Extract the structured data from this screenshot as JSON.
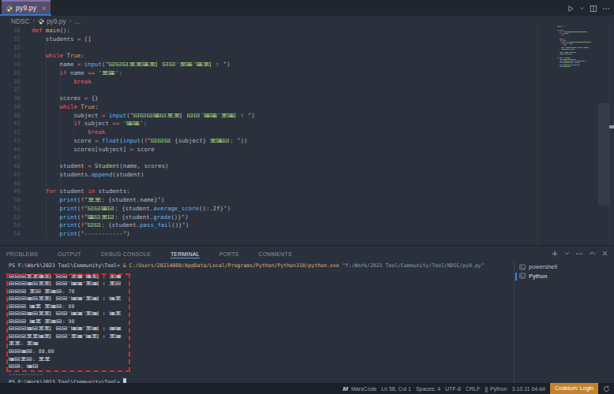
{
  "window": {
    "tab": {
      "label": "py9.py",
      "icon": "python-logo",
      "modified": false
    },
    "editor_actions": [
      "run-or-debug",
      "split-editor",
      "more-actions"
    ]
  },
  "breadcrumb": {
    "items": [
      "NDSC",
      "py9.py",
      "…"
    ]
  },
  "editor": {
    "first_visible_line": 30,
    "last_visible_line": 54,
    "lines": [
      {
        "n": 30,
        "tokens": [
          [
            "kw",
            "def"
          ],
          [
            "txt",
            " "
          ],
          [
            "defn",
            "main"
          ],
          [
            "txt",
            "():"
          ]
        ]
      },
      {
        "n": 31,
        "tokens": [
          [
            "txt",
            "    students "
          ],
          [
            "op",
            "="
          ],
          [
            "txt",
            " []"
          ]
        ]
      },
      {
        "n": 32,
        "tokens": []
      },
      {
        "n": 33,
        "tokens": [
          [
            "txt",
            "    "
          ],
          [
            "kw",
            "while"
          ],
          [
            "txt",
            " "
          ],
          [
            "num",
            "True"
          ],
          [
            "txt",
            ":"
          ]
        ]
      },
      {
        "n": 34,
        "tokens": [
          [
            "txt",
            "        name "
          ],
          [
            "op",
            "="
          ],
          [
            "txt",
            " "
          ],
          [
            "fn",
            "input"
          ],
          [
            "txt",
            "("
          ],
          [
            "str",
            "\"请输入学生姓名（输入'结束'退出）：\""
          ],
          [
            "txt",
            ")"
          ]
        ]
      },
      {
        "n": 35,
        "tokens": [
          [
            "txt",
            "        "
          ],
          [
            "kw",
            "if"
          ],
          [
            "txt",
            " name "
          ],
          [
            "op",
            "=="
          ],
          [
            "txt",
            " "
          ],
          [
            "str",
            "'结束'"
          ],
          [
            "txt",
            ":"
          ]
        ]
      },
      {
        "n": 36,
        "tokens": [
          [
            "txt",
            "            "
          ],
          [
            "kw",
            "break"
          ]
        ]
      },
      {
        "n": 37,
        "tokens": []
      },
      {
        "n": 38,
        "tokens": [
          [
            "txt",
            "        scores "
          ],
          [
            "op",
            "="
          ],
          [
            "txt",
            " {}"
          ]
        ]
      },
      {
        "n": 39,
        "tokens": [
          [
            "txt",
            "        "
          ],
          [
            "kw",
            "while"
          ],
          [
            "txt",
            " "
          ],
          [
            "num",
            "True"
          ],
          [
            "txt",
            ":"
          ]
        ]
      },
      {
        "n": 40,
        "tokens": [
          [
            "txt",
            "            subject "
          ],
          [
            "op",
            "="
          ],
          [
            "txt",
            " "
          ],
          [
            "fn",
            "input"
          ],
          [
            "txt",
            "("
          ],
          [
            "str",
            "\"请输入科目名称（输入'完成'结束）：\""
          ],
          [
            "txt",
            ")"
          ]
        ]
      },
      {
        "n": 41,
        "tokens": [
          [
            "txt",
            "            "
          ],
          [
            "kw",
            "if"
          ],
          [
            "txt",
            " subject "
          ],
          [
            "op",
            "=="
          ],
          [
            "txt",
            " "
          ],
          [
            "str",
            "'完成'"
          ],
          [
            "txt",
            ":"
          ]
        ]
      },
      {
        "n": 42,
        "tokens": [
          [
            "txt",
            "                "
          ],
          [
            "kw",
            "break"
          ]
        ]
      },
      {
        "n": 43,
        "tokens": [
          [
            "txt",
            "            score "
          ],
          [
            "op",
            "="
          ],
          [
            "txt",
            " "
          ],
          [
            "fn",
            "float"
          ],
          [
            "txt",
            "("
          ],
          [
            "fn",
            "input"
          ],
          [
            "txt",
            "("
          ],
          [
            "op",
            "f"
          ],
          [
            "str",
            "\"请输入 "
          ],
          [
            "txt",
            "{subject}"
          ],
          [
            "str",
            " 的成绩: \""
          ],
          [
            "txt",
            "))"
          ]
        ]
      },
      {
        "n": 44,
        "tokens": [
          [
            "txt",
            "            scores[subject] "
          ],
          [
            "op",
            "="
          ],
          [
            "txt",
            " score"
          ]
        ]
      },
      {
        "n": 45,
        "tokens": []
      },
      {
        "n": 46,
        "tokens": [
          [
            "txt",
            "        student "
          ],
          [
            "op",
            "="
          ],
          [
            "txt",
            " "
          ],
          [
            "cls",
            "Student"
          ],
          [
            "txt",
            "(name, scores)"
          ]
        ]
      },
      {
        "n": 47,
        "tokens": [
          [
            "txt",
            "        students."
          ],
          [
            "fn",
            "append"
          ],
          [
            "txt",
            "(student)"
          ]
        ]
      },
      {
        "n": 48,
        "tokens": []
      },
      {
        "n": 49,
        "tokens": [
          [
            "txt",
            "    "
          ],
          [
            "kw",
            "for"
          ],
          [
            "txt",
            " student "
          ],
          [
            "kw",
            "in"
          ],
          [
            "txt",
            " students:"
          ]
        ]
      },
      {
        "n": 50,
        "tokens": [
          [
            "txt",
            "        "
          ],
          [
            "fn",
            "print"
          ],
          [
            "txt",
            "("
          ],
          [
            "op",
            "f"
          ],
          [
            "str",
            "\"学生: "
          ],
          [
            "txt",
            "{student.name}"
          ],
          [
            "str",
            "\""
          ],
          [
            "txt",
            ")"
          ]
        ]
      },
      {
        "n": 51,
        "tokens": [
          [
            "txt",
            "        "
          ],
          [
            "fn",
            "print"
          ],
          [
            "txt",
            "("
          ],
          [
            "op",
            "f"
          ],
          [
            "str",
            "\"平均成绩: "
          ],
          [
            "txt",
            "{student."
          ],
          [
            "fn",
            "average_score"
          ],
          [
            "txt",
            "():.2f}"
          ],
          [
            "str",
            "\""
          ],
          [
            "txt",
            ")"
          ]
        ]
      },
      {
        "n": 52,
        "tokens": [
          [
            "txt",
            "        "
          ],
          [
            "fn",
            "print"
          ],
          [
            "txt",
            "("
          ],
          [
            "op",
            "f"
          ],
          [
            "str",
            "\"成绩等级: "
          ],
          [
            "txt",
            "{student."
          ],
          [
            "fn",
            "grade"
          ],
          [
            "txt",
            "()}"
          ],
          [
            "str",
            "\""
          ],
          [
            "txt",
            ")"
          ]
        ]
      },
      {
        "n": 53,
        "tokens": [
          [
            "txt",
            "        "
          ],
          [
            "fn",
            "print"
          ],
          [
            "txt",
            "("
          ],
          [
            "op",
            "f"
          ],
          [
            "str",
            "\"总评: "
          ],
          [
            "txt",
            "{student."
          ],
          [
            "fn",
            "pass_fail"
          ],
          [
            "txt",
            "()}"
          ],
          [
            "str",
            "\""
          ],
          [
            "txt",
            ")"
          ]
        ]
      },
      {
        "n": 54,
        "tokens": [
          [
            "txt",
            "        "
          ],
          [
            "fn",
            "print"
          ],
          [
            "txt",
            "("
          ],
          [
            "str",
            "\"-----------\""
          ],
          [
            "txt",
            ")"
          ]
        ]
      }
    ]
  },
  "panel": {
    "tabs": [
      {
        "label": "PROBLEMS"
      },
      {
        "label": "OUTPUT"
      },
      {
        "label": "DEBUG CONSOLE"
      },
      {
        "label": "TERMINAL"
      },
      {
        "label": "PORTS"
      },
      {
        "label": "COMMENTS"
      }
    ],
    "active_tab": "TERMINAL",
    "header_icons": [
      "new-terminal",
      "launch-profile-chevron",
      "more-actions",
      "maximize-panel",
      "close-panel"
    ]
  },
  "terminal": {
    "lines": [
      {
        "segs": [
          [
            "p",
            "PS F:\\Work\\2023 Tool\\Community\\Tool> "
          ],
          [
            "y",
            "& C:/Users/20214080/AppData/Local/Programs/Python/Python310/python.exe "
          ],
          [
            "a",
            "\"f:/Work/2023 Tool/Community/Tool/NDSC/py9.py\""
          ]
        ]
      },
      {
        "segs": [
          [
            "o",
            "请输入学生姓名（输入'结束'退出）：张三"
          ]
        ]
      },
      {
        "segs": [
          [
            "o",
            "请输入科目名称（输入'完成'结束）：语文"
          ]
        ]
      },
      {
        "segs": [
          [
            "o",
            "请输入 语文 的成绩: 70"
          ]
        ]
      },
      {
        "segs": [
          [
            "o",
            "请输入科目名称（输入'完成'结束）：数学"
          ]
        ]
      },
      {
        "segs": [
          [
            "o",
            "请输入 数学 的成绩: 80"
          ]
        ]
      },
      {
        "segs": [
          [
            "o",
            "请输入科目名称（输入'完成'结束）：外语"
          ]
        ]
      },
      {
        "segs": [
          [
            "o",
            "请输入 外语 的成绩: 90"
          ]
        ]
      },
      {
        "segs": [
          [
            "o",
            "请输入科目名称（输入'完成'结束）：完成"
          ]
        ]
      },
      {
        "segs": [
          [
            "o",
            "请输入学生姓名（输入'结束'退出）：结束"
          ]
        ]
      },
      {
        "segs": [
          [
            "o",
            "学生: 张三"
          ]
        ]
      },
      {
        "segs": [
          [
            "o",
            "平均成绩: 80.00"
          ]
        ]
      },
      {
        "segs": [
          [
            "o",
            "成绩等级: 良好"
          ]
        ]
      },
      {
        "segs": [
          [
            "o",
            "总评: 及格"
          ]
        ]
      },
      {
        "segs": [
          [
            "o",
            "-----------"
          ]
        ]
      },
      {
        "segs": [
          [
            "p",
            "PS F:\\Work\\2023 Tool\\Community\\Tool> "
          ],
          [
            "cursor",
            ""
          ]
        ]
      }
    ],
    "annotation": {
      "type": "red-dashed-rectangle",
      "color": "#d62b2b"
    }
  },
  "terminal_sidebar": {
    "items": [
      {
        "label": "powershell",
        "icon": "terminal-icon",
        "active": false
      },
      {
        "label": "Python",
        "icon": "terminal-icon",
        "active": true
      }
    ]
  },
  "status_bar": {
    "marscode": "MarsCode",
    "line_col": "Ln 58, Col 1",
    "indentation": "Spaces: 4",
    "encoding": "UTF-8",
    "eol": "CRLF",
    "language": "Python",
    "interpreter": "3.10.11 64-bit",
    "codeium": "Codeium: Login"
  },
  "colors": {
    "editor_background": "#2b313c",
    "tabbar_background": "#21252e",
    "active_tab_background": "#574f69",
    "active_tab_top_border": "#8172ad",
    "active_tab_bottom_line": "#3277c8",
    "statusbar_background": "#1b2029",
    "codeium_badge": "#c4812c",
    "panel_active_tab_underline": "#4da0dd",
    "annotation_red": "#d62b2b",
    "syntax": {
      "keyword": "#e35d6d",
      "function": "#61afef",
      "string": "#98c379",
      "number": "#d19a66",
      "operator": "#cf6a75",
      "class": "#9fd47f",
      "definition": "#dfa96a",
      "text": "#adb4c2"
    }
  }
}
